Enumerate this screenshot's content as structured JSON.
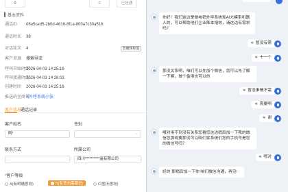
{
  "top_cards": {
    "c1_value": "0",
    "c2_value": "0",
    "c3_label": "已挂通"
  },
  "basic": {
    "title": "基本资料",
    "rows": [
      {
        "label": "通话ID",
        "value": "08a5ced5-2b0d-4616-8f1a-800a7c30a516"
      },
      {
        "label": "通话时长",
        "value": "38"
      },
      {
        "label": "对话轮次",
        "value": "4"
      },
      {
        "label": "客户来源",
        "value": "搜索导流"
      },
      {
        "label": "呼叫开始时间",
        "value": "2026-04-03 14:25:16"
      },
      {
        "label": "呼叫接通时间",
        "value": "2026-04-03 14:26:03"
      },
      {
        "label": "创建时间",
        "value": "2026-04-03 14:25:16"
      },
      {
        "label": "推送的坐席号",
        "value": "A外呼系统小张"
      }
    ],
    "tag_button": "去编辑标签"
  },
  "tabs": {
    "customer_info": "客户信息",
    "call_record": "通话记录"
  },
  "form": {
    "name_label": "客户姓名",
    "name_value": "阿*",
    "gender_label": "性别",
    "contact_label": "联系方式",
    "company_label": "所属公司",
    "company_value": "四川**********遥有限公司",
    "level_label": "客户等级",
    "level_options": [
      "A(有明确意向)",
      "B(有意向需跟进)",
      "C(暂无意向)"
    ],
    "level_selected": 1
  },
  "chat": {
    "messages": [
      {
        "from": "bot",
        "text": "你好！我们这边是做电销外呼系统和AI大模型机器人的，可以帮助他们企业降本增效，请这边有需求吗？"
      },
      {
        "from": "user",
        "text": "暂没有需"
      },
      {
        "from": "user",
        "text": "十一个"
      },
      {
        "from": "bot",
        "text": "那没关系啊，咱们可以先加个微信，您可以先了解一下嘛，做个备用也可以的"
      },
      {
        "from": "user",
        "text": "暂没事情不需"
      },
      {
        "from": "user",
        "text": "需要啊"
      },
      {
        "from": "user",
        "text": "谢"
      },
      {
        "from": "bot",
        "text": "哦对用不到没有关系您看您这边稍后加一下我的微信您那现要那没可以咱们家系统们您的手机号是您的微信号吗？"
      },
      {
        "from": "user",
        "text": "嗯对"
      },
      {
        "from": "bot",
        "text": "好的 那稍后加一下你 咱们微信沟通，再见!"
      }
    ]
  }
}
